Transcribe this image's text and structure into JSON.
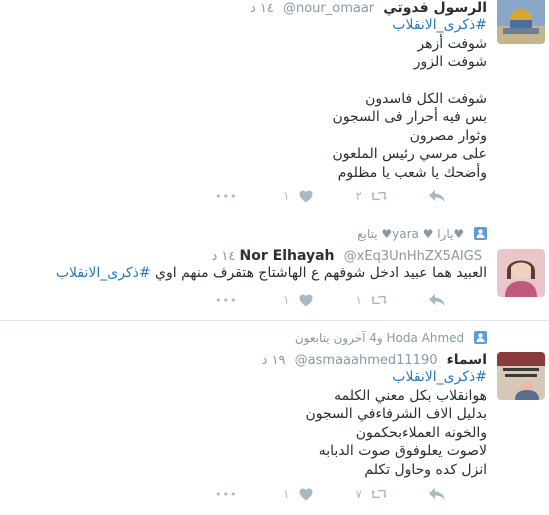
{
  "tweets": [
    {
      "name": "الرسول فدوتي",
      "username": "@nour_omaar",
      "time": "١٤ د",
      "body_lines": [
        "شوفت أزهر",
        "شوفت الزور",
        "",
        "شوفت الكل فاسدون",
        "بس فيه أحرار فى السجون",
        "وثوار مصرون",
        "على مرسي رئيس الملعون",
        "وأضحك يا شعب يا مظلوم"
      ],
      "hashtag": "#ذكرى_الانقلاب",
      "retweets": "٢",
      "likes": "١",
      "more": "•••"
    },
    {
      "context": "♥يارا ♥ yara♥ يتابع",
      "name": "Nor Elhayah",
      "username": "@xEq3UnHhZX5AIGS",
      "time": "١٤ د",
      "body_text": "العبيد هما عبيد ادخل شوفهم ع الهاشتاج هتقرف منهم اوي",
      "hashtag": "#ذكرى_الانقلاب",
      "retweets": "١",
      "likes": "١",
      "more": "•••"
    },
    {
      "context": "Hoda Ahmed و4 آخرون يتابعون",
      "name": "اسماء",
      "username": "@asmaaahmed11190",
      "time": "١٩ د",
      "hashtag": "#ذكرى_الانقلاب",
      "body_lines": [
        "هوانقلاب بكل معني الكلمه",
        "بدليل الاف الشرفاءفي السجون",
        "والخونه العملاءبحكمون",
        "لاصوت يعلوفوق صوت الدبابه",
        "انزل كده وحاول تكلم"
      ],
      "retweets": "٧",
      "likes": "١",
      "more": "•••"
    }
  ],
  "colors": {
    "muted": "#8899a6",
    "hashtag": "#2b7bb9",
    "action": "#aab8c2",
    "border": "#e1e8ed"
  },
  "icons": {
    "reply": "reply-icon",
    "retweet": "retweet-icon",
    "like": "heart-icon",
    "more": "more-icon",
    "follow": "person-icon"
  }
}
